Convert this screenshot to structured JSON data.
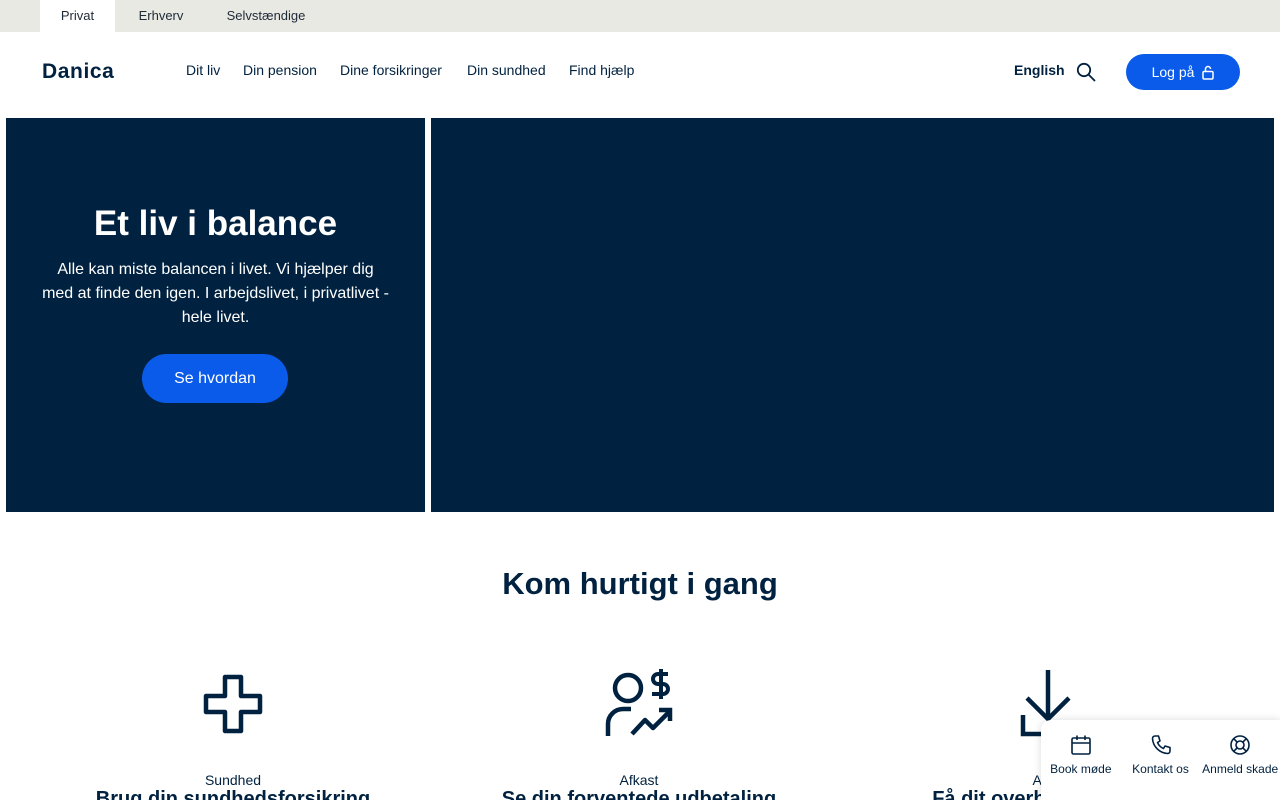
{
  "segments": [
    "Privat",
    "Erhverv",
    "Selvstændige"
  ],
  "header": {
    "logo": "Danica",
    "nav": [
      "Dit liv",
      "Din pension",
      "Dine forsikringer",
      "Din sundhed",
      "Find hjælp"
    ],
    "language": "English",
    "login_label": "Log på"
  },
  "hero": {
    "title": "Et liv i balance",
    "text_lines": [
      "Alle kan miste balancen i livet. Vi hjælper dig",
      "med at finde den igen. I arbejdslivet, i privatlivet -",
      "hele livet."
    ],
    "button": "Se hvordan"
  },
  "section": {
    "title": "Kom hurtigt i gang"
  },
  "cards": [
    {
      "kicker": "Sundhed",
      "heading": "Brug din sundhedsforsikring",
      "icon": "plus-cross-icon"
    },
    {
      "kicker": "Afkast",
      "heading": "Se din forventede udbetaling",
      "icon": "user-dollar-trend-icon"
    },
    {
      "kicker": "App",
      "heading": "Få dit overblik på farten",
      "icon": "download-arrow-icon"
    }
  ],
  "quick_actions": [
    {
      "label": "Book møde",
      "icon": "calendar-icon"
    },
    {
      "label": "Kontakt os",
      "icon": "phone-icon"
    },
    {
      "label": "Anmeld skade",
      "icon": "lifebuoy-icon"
    }
  ],
  "colors": {
    "navy": "#00213f",
    "blue": "#0a5bea",
    "topbar": "#e9e9e4"
  }
}
